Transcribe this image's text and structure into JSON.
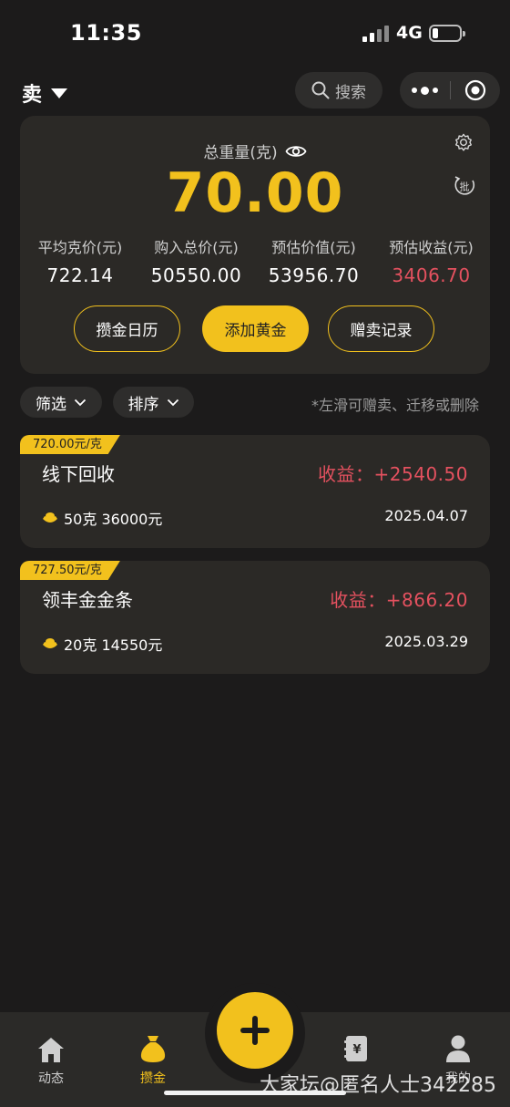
{
  "status": {
    "time": "11:35",
    "network": "4G"
  },
  "header": {
    "mode": "卖",
    "search_label": "搜索"
  },
  "summary": {
    "weight_label": "总重量(克)",
    "weight_value": "70.00",
    "stats": [
      {
        "label": "平均克价(元)",
        "value": "722.14"
      },
      {
        "label": "购入总价(元)",
        "value": "50550.00"
      },
      {
        "label": "预估价值(元)",
        "value": "53956.70"
      },
      {
        "label": "预估收益(元)",
        "value": "3406.70"
      }
    ],
    "actions": {
      "calendar": "攒金日历",
      "add": "添加黄金",
      "gift": "赠卖记录"
    }
  },
  "filters": {
    "filter_label": "筛选",
    "sort_label": "排序",
    "hint": "*左滑可赠卖、迁移或删除"
  },
  "records": [
    {
      "price_tag": "720.00元/克",
      "title": "线下回收",
      "profit": "收益：+2540.50",
      "info": "50克  36000元",
      "date": "2025.04.07"
    },
    {
      "price_tag": "727.50元/克",
      "title": "领丰金金条",
      "profit": "收益：+866.20",
      "info": "20克  14550元",
      "date": "2025.03.29"
    }
  ],
  "nav": {
    "items": [
      {
        "label": "动态"
      },
      {
        "label": "攒金"
      },
      {
        "label": ""
      },
      {
        "label": "我的"
      }
    ]
  },
  "watermark": "大家坛@匿名人士342285",
  "colors": {
    "accent": "#f2c11d",
    "profit_red": "#e4515f",
    "card_bg": "#2b2926",
    "page_bg": "#1c1b1b"
  }
}
